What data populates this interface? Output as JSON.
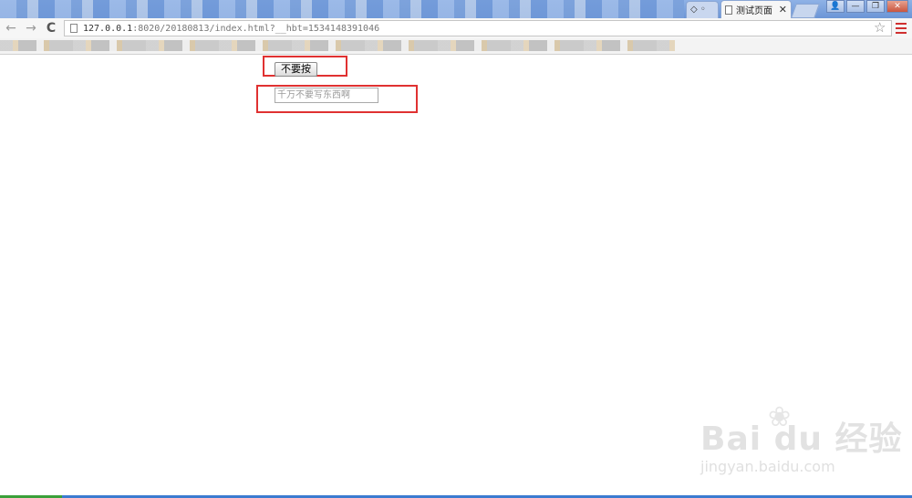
{
  "browser": {
    "tabs": [
      {
        "label": "◇ ◦",
        "active": false
      },
      {
        "label": "测试页面",
        "active": true,
        "close": "✕"
      }
    ],
    "window_controls": {
      "user": "👤",
      "minimize": "—",
      "restore": "❐",
      "close": "✕"
    },
    "nav": {
      "back": "←",
      "forward": "→",
      "reload": "C"
    },
    "address": {
      "host": "127.0.0.1",
      "rest": ":8020/20180813/index.html?__hbt=1534148391046"
    },
    "star": "☆"
  },
  "page": {
    "button_label": "不要按",
    "input_placeholder": "千万不要写东西啊",
    "input_value": ""
  },
  "watermark": {
    "logo": "Bai  du 经验",
    "url": "jingyan.baidu.com"
  },
  "colors": {
    "highlight": "#e03131",
    "chrome_frame": "#6b95d6"
  }
}
